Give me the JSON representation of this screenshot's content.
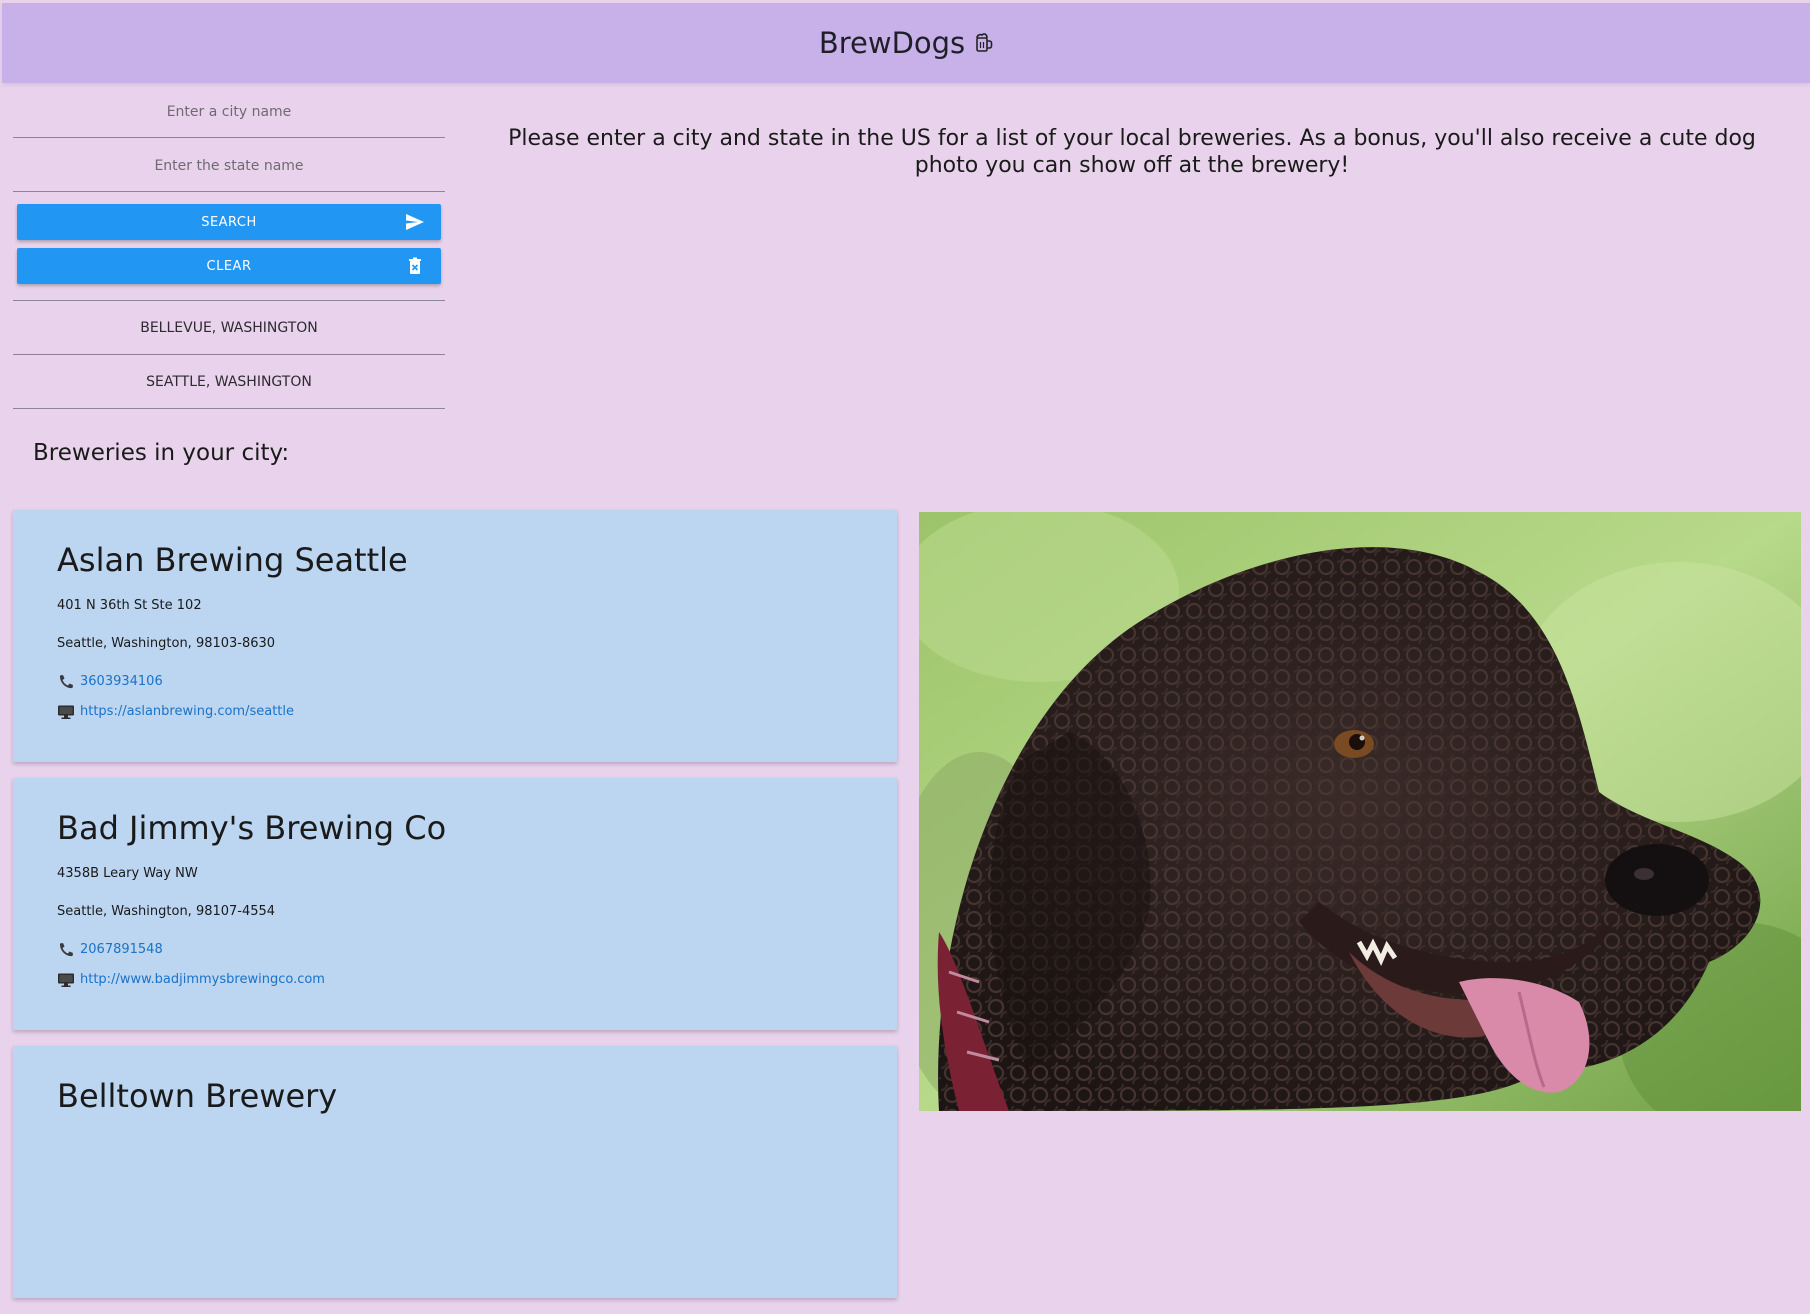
{
  "header": {
    "title": "BrewDogs",
    "icon": "beer-mug-icon"
  },
  "search": {
    "city_placeholder": "Enter a city name",
    "city_value": "",
    "state_placeholder": "Enter the state name",
    "state_value": "",
    "search_label": "SEARCH",
    "search_icon": "send-icon",
    "clear_label": "CLEAR",
    "clear_icon": "trash-icon"
  },
  "history": [
    {
      "label": "BELLEVUE, WASHINGTON"
    },
    {
      "label": "SEATTLE, WASHINGTON"
    }
  ],
  "intro": {
    "text": "Please enter a city and state in the US for a list of your local breweries. As a bonus, you'll also receive a cute dog photo you can show off at the brewery!"
  },
  "results": {
    "heading": "Breweries in your city:",
    "breweries": [
      {
        "name": "Aslan Brewing Seattle",
        "street": "401 N 36th St Ste 102",
        "city_line": "Seattle, Washington, 98103-8630",
        "phone": "3603934106",
        "website": "https://aslanbrewing.com/seattle"
      },
      {
        "name": "Bad Jimmy's Brewing Co",
        "street": "4358B Leary Way NW",
        "city_line": "Seattle, Washington, 98107-4554",
        "phone": "2067891548",
        "website": "http://www.badjimmysbrewingco.com"
      },
      {
        "name": "Belltown Brewery",
        "street": "",
        "city_line": "",
        "phone": "",
        "website": ""
      }
    ]
  },
  "dog_photo": {
    "subject": "curly-coated dark brown dog"
  },
  "colors": {
    "page_bg": "#e9d3ec",
    "header_bg": "#c8b1e9",
    "button_bg": "#2196f3",
    "card_bg": "#bcd5f0",
    "link": "#1a73c9"
  }
}
